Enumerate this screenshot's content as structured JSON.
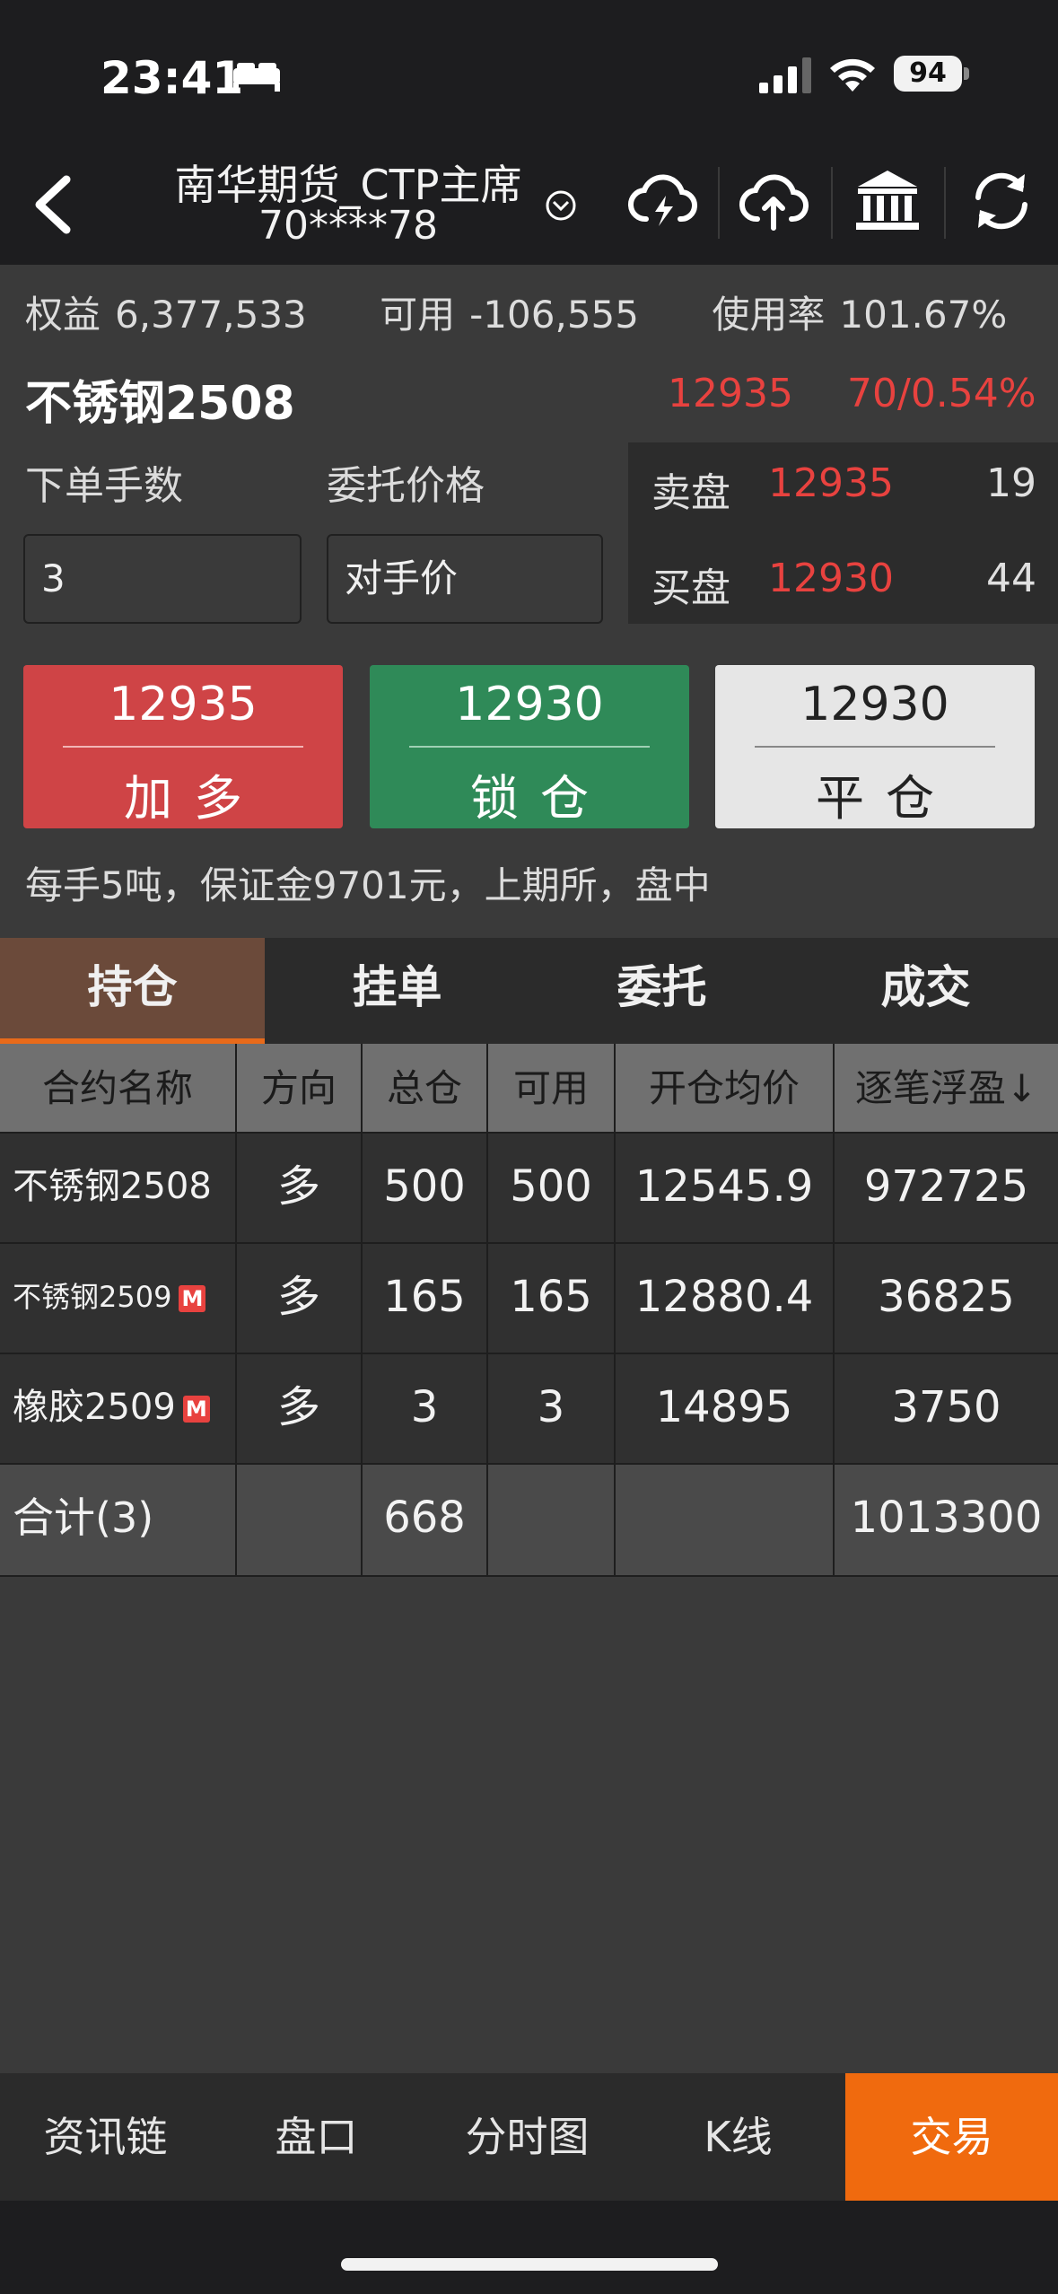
{
  "status_bar": {
    "time": "23:41",
    "battery": "94"
  },
  "header": {
    "account_name": "南华期货_CTP主席",
    "account_no": "70****78"
  },
  "summary": {
    "equity_label": "权益",
    "equity_value": "6,377,533",
    "available_label": "可用",
    "available_value": "-106,555",
    "usage_label": "使用率",
    "usage_value": "101.67%"
  },
  "contract": {
    "name": "不锈钢2508",
    "last_price": "12935",
    "change": "70/0.54%"
  },
  "order_form": {
    "lots_label": "下单手数",
    "lots_value": "3",
    "price_label": "委托价格",
    "price_value": "对手价"
  },
  "order_book": {
    "ask_label": "卖盘",
    "ask_price": "12935",
    "ask_qty": "19",
    "bid_label": "买盘",
    "bid_price": "12930",
    "bid_qty": "44"
  },
  "actions": {
    "buy_price": "12935",
    "buy_label": "加多",
    "lock_price": "12930",
    "lock_label": "锁仓",
    "close_price": "12930",
    "close_label": "平仓"
  },
  "note": "每手5吨，保证金9701元，上期所，盘中",
  "tabs": [
    "持仓",
    "挂单",
    "委托",
    "成交"
  ],
  "positions": {
    "columns": [
      "合约名称",
      "方向",
      "总仓",
      "可用",
      "开仓均价",
      "逐笔浮盈↓"
    ],
    "rows": [
      {
        "name": "不锈钢2508",
        "badge": "",
        "direction": "多",
        "total": "500",
        "available": "500",
        "avg_price": "12545.9",
        "pnl": "972725"
      },
      {
        "name": "不锈钢2509",
        "badge": "M",
        "direction": "多",
        "total": "165",
        "available": "165",
        "avg_price": "12880.4",
        "pnl": "36825"
      },
      {
        "name": "橡胶2509",
        "badge": "M",
        "direction": "多",
        "total": "3",
        "available": "3",
        "avg_price": "14895",
        "pnl": "3750"
      }
    ],
    "total_row": {
      "label": "合计(3)",
      "total": "668",
      "pnl": "1013300"
    }
  },
  "bottom_nav": [
    "资讯链",
    "盘口",
    "分时图",
    "K线",
    "交易"
  ],
  "colors": {
    "up": "#e8423f",
    "buy_button": "#cf4446",
    "lock_button": "#2f8a58",
    "close_button": "#e6e6e6",
    "accent": "#f06a0e"
  }
}
